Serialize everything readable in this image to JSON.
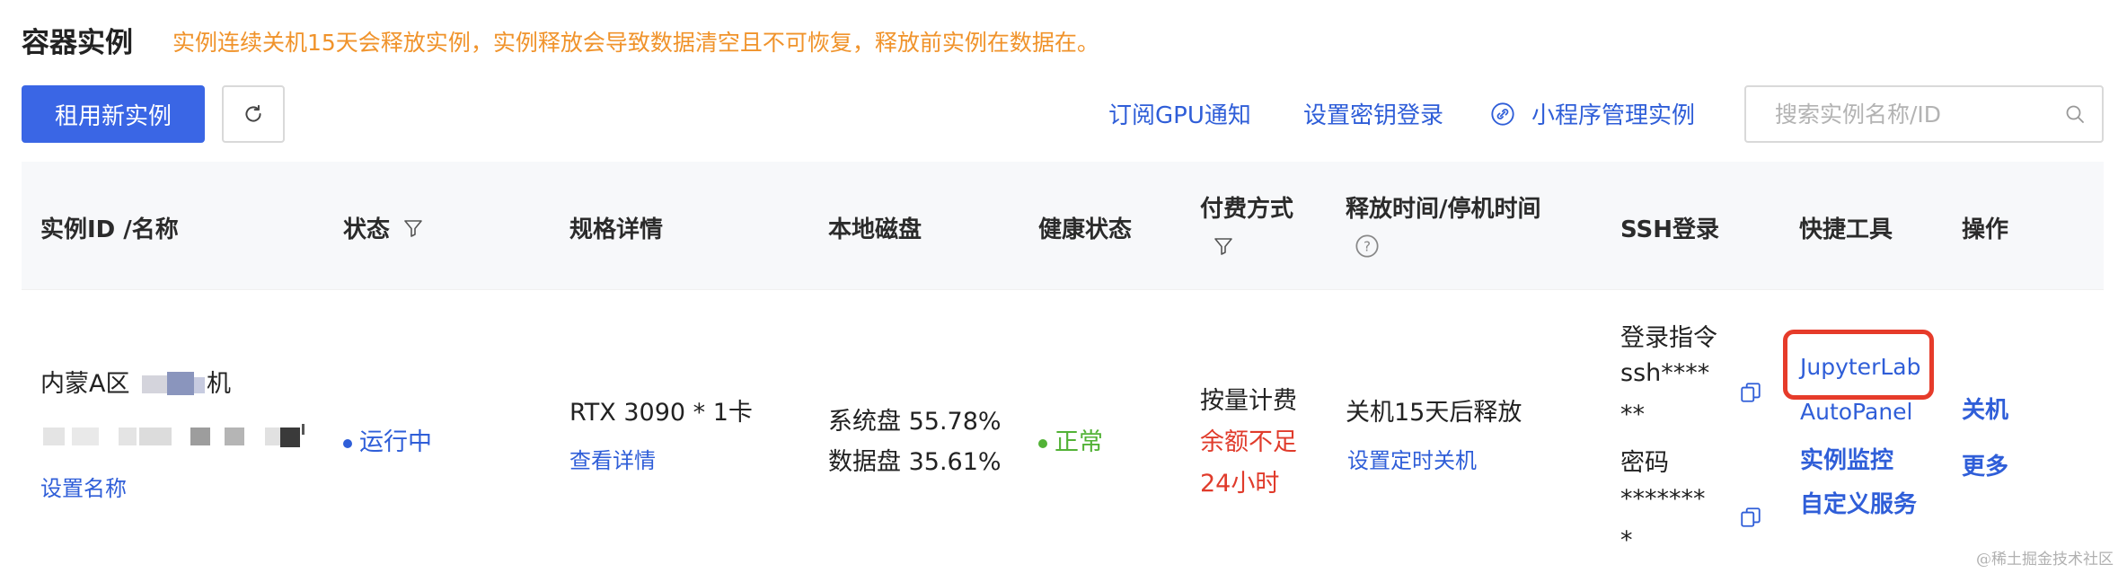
{
  "header": {
    "title": "容器实例",
    "notice": "实例连续关机15天会释放实例，实例释放会导致数据清空且不可恢复，释放前实例在数据在。"
  },
  "toolbar": {
    "rent_button": "租用新实例",
    "refresh_icon": "refresh-icon",
    "subscribe_gpu": "订阅GPU通知",
    "set_key_login": "设置密钥登录",
    "mini_program": "小程序管理实例",
    "search_placeholder": "搜索实例名称/ID"
  },
  "table": {
    "columns": {
      "instance": "实例ID /名称",
      "status": "状态",
      "spec": "规格详情",
      "disk": "本地磁盘",
      "health": "健康状态",
      "billing": "付费方式",
      "release": "释放时间/停机时间",
      "ssh": "SSH登录",
      "tools": "快捷工具",
      "actions": "操作"
    },
    "row": {
      "name": "内蒙A区",
      "name_suffix": "机",
      "set_name": "设置名称",
      "status": "运行中",
      "spec": "RTX 3090 * 1卡",
      "view_detail": "查看详情",
      "system_disk": "系统盘 55.78%",
      "data_disk": "数据盘 35.61%",
      "health": "正常",
      "billing": "按量计费",
      "balance_warning_1": "余额不足",
      "balance_warning_2": "24小时",
      "release_text": "关机15天后释放",
      "set_timer": "设置定时关机",
      "ssh_cmd_label": "登录指令",
      "ssh_cmd_1": "ssh****",
      "ssh_cmd_2": "**",
      "password_label": "密码",
      "password_1": "*******",
      "password_2": "*",
      "tools": [
        "JupyterLab",
        "AutoPanel",
        "实例监控",
        "自定义服务"
      ],
      "action_shutdown": "关机",
      "action_more": "更多"
    }
  },
  "watermark": "@稀土掘金技术社区",
  "colors": {
    "primary": "#3a66e5",
    "link": "#2f5ed8",
    "warning": "#f0932b",
    "danger": "#e03b2b",
    "success": "#52b236",
    "highlight": "#e63b2a"
  }
}
